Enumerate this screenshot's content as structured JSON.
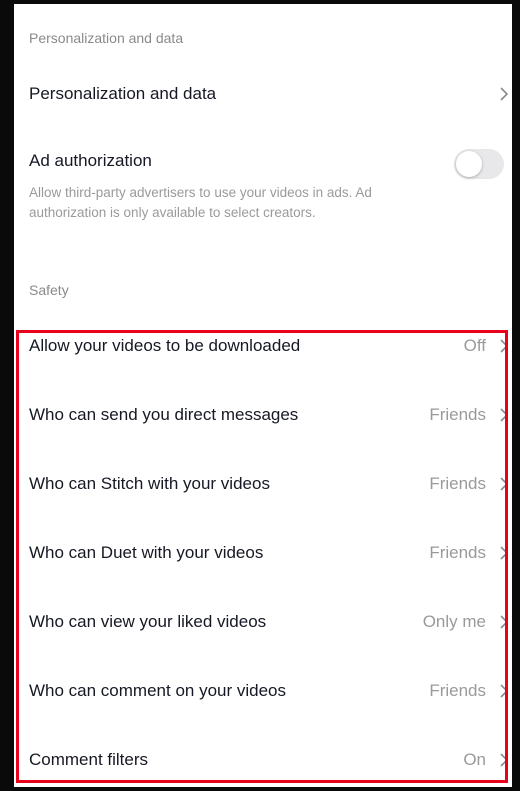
{
  "sections": {
    "personalization_header": "Personalization and data",
    "safety_header": "Safety"
  },
  "personalization_row": {
    "label": "Personalization and data"
  },
  "ad_authorization": {
    "label": "Ad authorization",
    "description": "Allow third-party advertisers to use your videos in ads. Ad authorization is only available to select creators.",
    "enabled": false
  },
  "safety_items": [
    {
      "label": "Allow your videos to be downloaded",
      "value": "Off"
    },
    {
      "label": "Who can send you direct messages",
      "value": "Friends"
    },
    {
      "label": "Who can Stitch with your videos",
      "value": "Friends"
    },
    {
      "label": "Who can Duet with your videos",
      "value": "Friends"
    },
    {
      "label": "Who can view your liked videos",
      "value": "Only me"
    },
    {
      "label": "Who can comment on your videos",
      "value": "Friends"
    },
    {
      "label": "Comment filters",
      "value": "On"
    }
  ],
  "colors": {
    "highlight": "#e8001c",
    "text_primary": "#161823",
    "text_secondary": "#9a9a9a"
  }
}
